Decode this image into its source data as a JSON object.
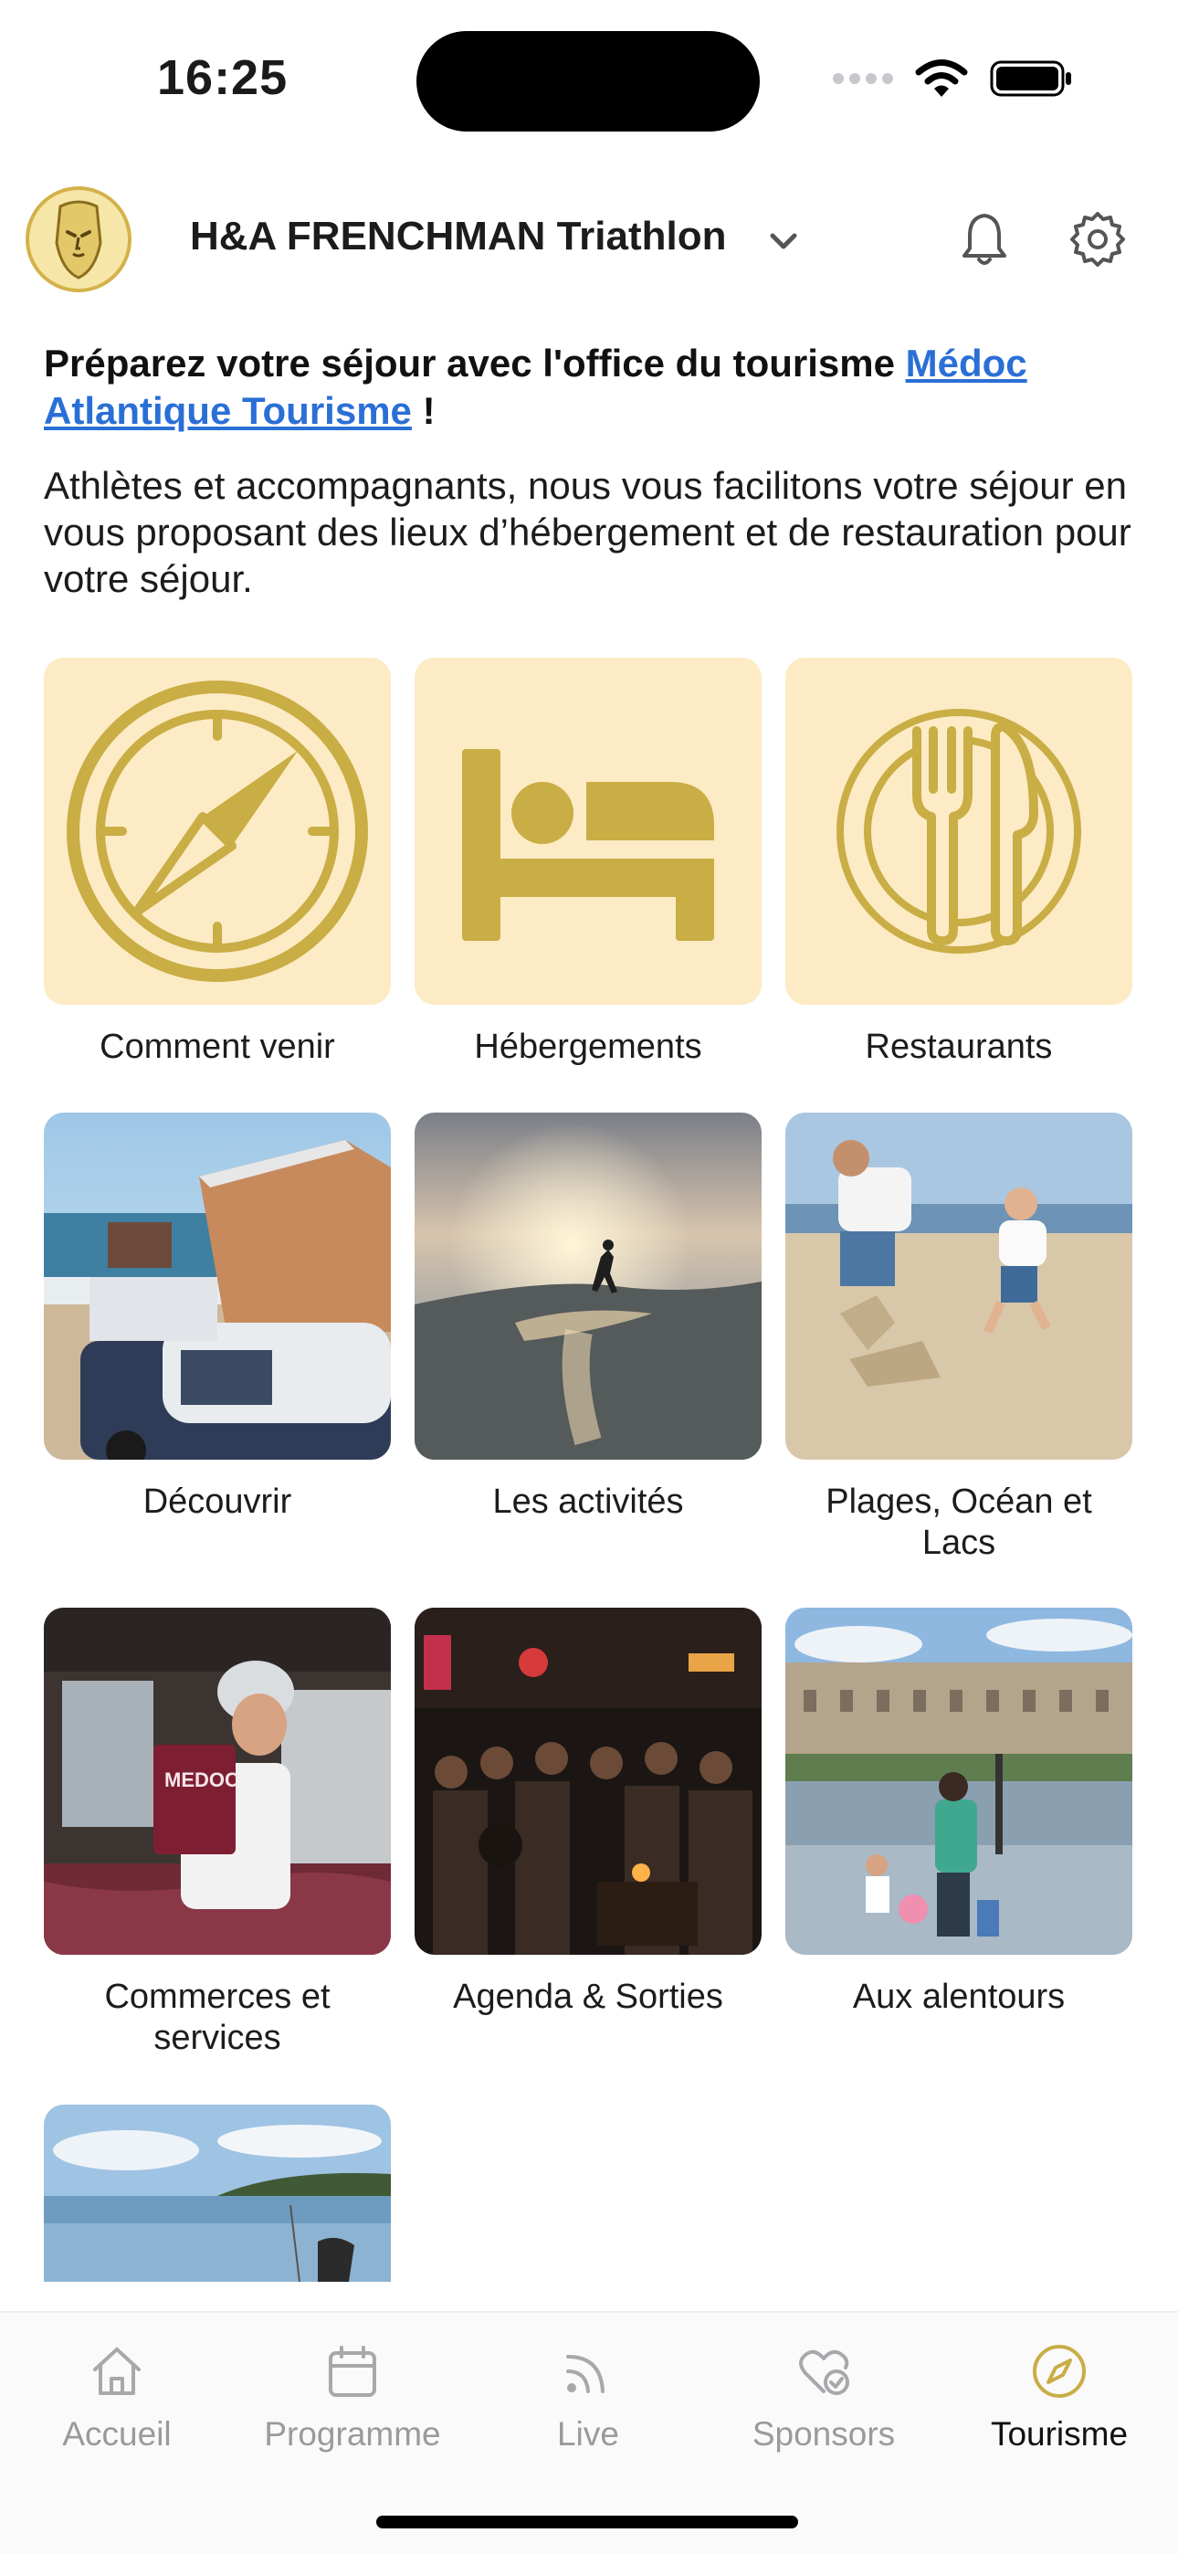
{
  "status": {
    "time": "16:25"
  },
  "header": {
    "title": "H&A FRENCHMAN Triathlon"
  },
  "intro": {
    "heading_prefix": "Préparez votre séjour avec l'office du tourisme ",
    "heading_link": "Médoc Atlantique Tourisme",
    "heading_suffix": " !",
    "description": "Athlètes et accompagnants, nous vous facilitons votre séjour en vous proposant des lieux d’hébergement et de restauration pour votre séjour."
  },
  "tiles": [
    {
      "label": "Comment venir",
      "icon": "compass-icon"
    },
    {
      "label": "Hébergements",
      "icon": "bed-icon"
    },
    {
      "label": "Restaurants",
      "icon": "plate-cutlery-icon"
    },
    {
      "label": "Découvrir",
      "image": "van-beach-photo"
    },
    {
      "label": "Les activités",
      "image": "surfer-sunset-photo"
    },
    {
      "label": "Plages, Océan et Lacs",
      "image": "beach-sandcastle-photo"
    },
    {
      "label": "Commerces et services",
      "image": "market-vendor-photo"
    },
    {
      "label": "Agenda & Sorties",
      "image": "night-crowd-photo"
    },
    {
      "label": "Aux alentours",
      "image": "city-square-photo"
    },
    {
      "label": "",
      "image": "lake-shore-photo"
    }
  ],
  "tabbar": {
    "items": [
      {
        "label": "Accueil",
        "icon": "home-icon"
      },
      {
        "label": "Programme",
        "icon": "calendar-icon"
      },
      {
        "label": "Live",
        "icon": "live-feed-icon"
      },
      {
        "label": "Sponsors",
        "icon": "sponsor-heart-icon"
      },
      {
        "label": "Tourisme",
        "icon": "compass-icon"
      }
    ],
    "active": "Tourisme"
  },
  "colors": {
    "accent_gold": "#c9ad45",
    "tile_bg": "#fcebc4",
    "link": "#2a6fd6"
  }
}
